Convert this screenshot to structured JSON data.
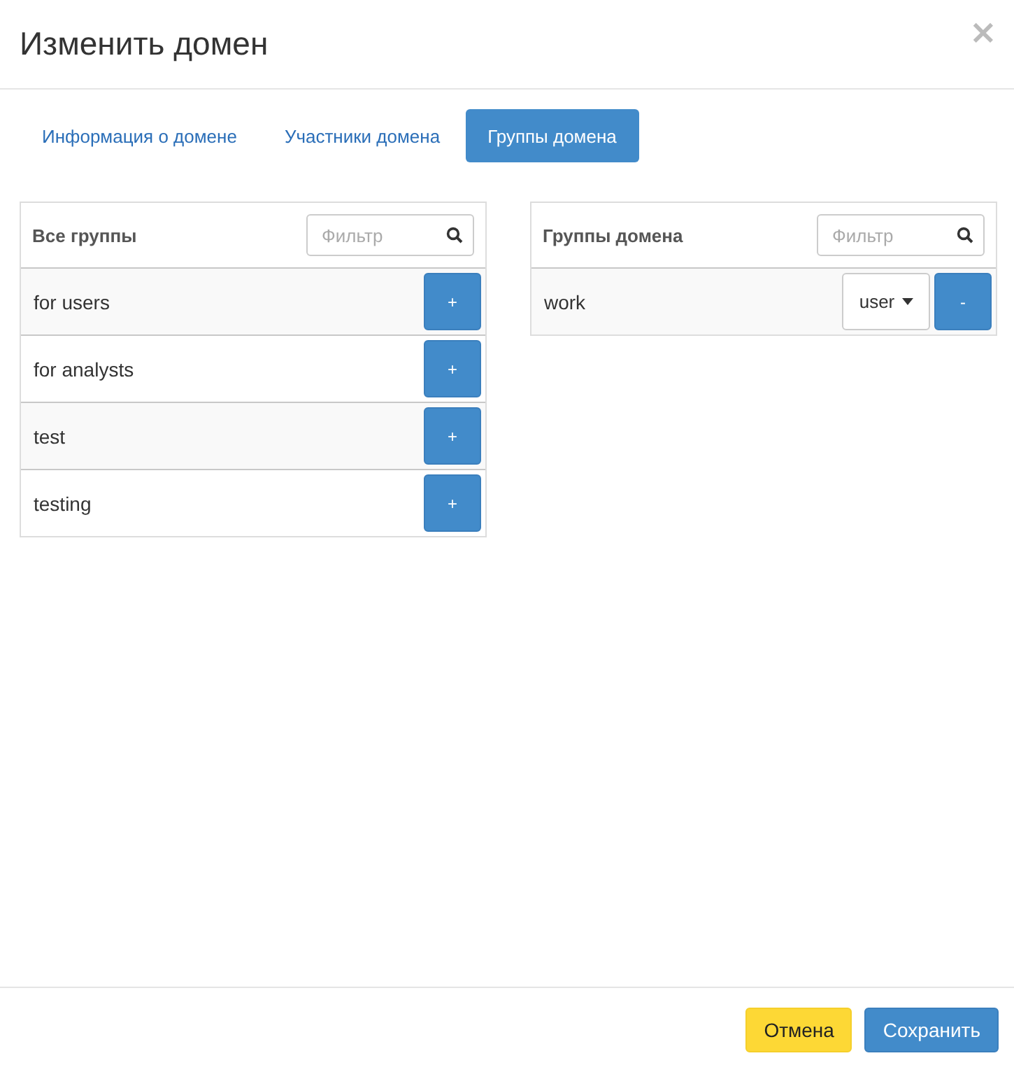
{
  "dialog": {
    "title": "Изменить домен",
    "close": "×"
  },
  "tabs": [
    {
      "label": "Информация о домене",
      "selected": false
    },
    {
      "label": "Участники домена",
      "selected": false
    },
    {
      "label": "Группы домена",
      "selected": true
    }
  ],
  "all_groups": {
    "title": "Все группы",
    "filter": {
      "placeholder": "Фильтр"
    },
    "rows": [
      {
        "name": "for users",
        "button": "+"
      },
      {
        "name": "for analysts",
        "button": "+"
      },
      {
        "name": "test",
        "button": "+"
      },
      {
        "name": "testing",
        "button": "+"
      }
    ]
  },
  "domain_groups": {
    "title": "Группы домена",
    "filter": {
      "placeholder": "Фильтр"
    },
    "rows": [
      {
        "name": "work",
        "role": "user",
        "button": "-"
      }
    ]
  },
  "buttons": [
    {
      "label": "Отмена",
      "kind": "cancel"
    },
    {
      "label": "Сохранить",
      "kind": "primary"
    }
  ]
}
